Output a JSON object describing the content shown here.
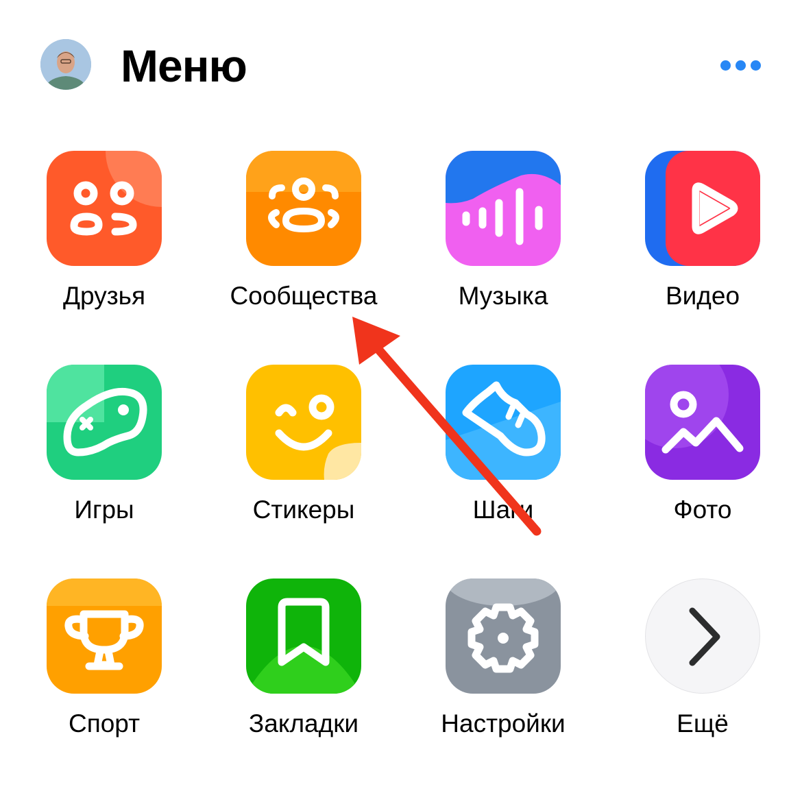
{
  "header": {
    "title": "Меню",
    "avatar_icon": "user-photo",
    "more_icon": "dots-horizontal-icon"
  },
  "colors": {
    "accent": "#2787f5",
    "annotation_arrow": "#f0341c"
  },
  "menu": {
    "items": [
      {
        "label": "Друзья",
        "icon": "friends-icon",
        "color": "#ff5a2a"
      },
      {
        "label": "Сообщества",
        "icon": "communities-icon",
        "color": "#ff8a00"
      },
      {
        "label": "Музыка",
        "icon": "music-icon",
        "color": "#f060f0"
      },
      {
        "label": "Видео",
        "icon": "video-icon",
        "color": "#ff3347"
      },
      {
        "label": "Игры",
        "icon": "games-icon",
        "color": "#1fcf7f"
      },
      {
        "label": "Стикеры",
        "icon": "stickers-icon",
        "color": "#ffc000"
      },
      {
        "label": "Шаги",
        "icon": "steps-icon",
        "color": "#1ea5ff"
      },
      {
        "label": "Фото",
        "icon": "photo-icon",
        "color": "#9130e0"
      },
      {
        "label": "Спорт",
        "icon": "sport-icon",
        "color": "#ffa000"
      },
      {
        "label": "Закладки",
        "icon": "bookmarks-icon",
        "color": "#18c40a"
      },
      {
        "label": "Настройки",
        "icon": "settings-icon",
        "color": "#8a939e"
      },
      {
        "label": "Ещё",
        "icon": "chevron-right-icon",
        "color": "#f5f5f7"
      }
    ]
  }
}
